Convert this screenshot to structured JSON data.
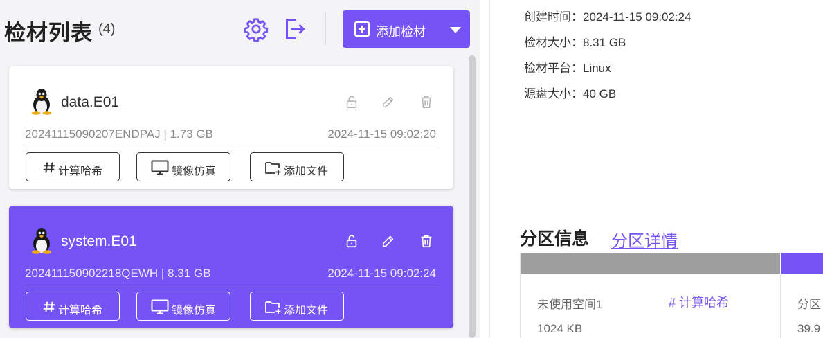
{
  "list": {
    "title": "检材列表",
    "count": "(4)",
    "add_button": "添加检材"
  },
  "cards": [
    {
      "name": "data.E01",
      "meta": "20241115090207ENDPAJ | 1.73 GB",
      "time": "2024-11-15 09:02:20",
      "btn_hash": "计算哈希",
      "btn_mirror": "镜像仿真",
      "btn_addfile": "添加文件"
    },
    {
      "name": "system.E01",
      "meta": "202411150902218QEWH | 8.31 GB",
      "time": "2024-11-15 09:02:24",
      "btn_hash": "计算哈希",
      "btn_mirror": "镜像仿真",
      "btn_addfile": "添加文件"
    }
  ],
  "details": {
    "created_label": "创建时间：",
    "created_value": "2024-11-15 09:02:24",
    "size_label": "检材大小：",
    "size_value": "8.31 GB",
    "platform_label": "检材平台：",
    "platform_value": "Linux",
    "disk_label": "源盘大小：",
    "disk_value": "40 GB"
  },
  "partition": {
    "title": "分区信息",
    "link": "分区详情",
    "unused_name": "未使用空间1",
    "hash_label": "计算哈希",
    "unused_size": "1024 KB",
    "next_name": "分区",
    "next_pct": "39.9"
  },
  "colors": {
    "accent": "#7553f4",
    "grey_bar": "#9e9e9e"
  },
  "icons": [
    "gear-icon",
    "export-icon",
    "plus-box-icon",
    "caret-down-icon",
    "linux-icon",
    "lock-icon",
    "edit-icon",
    "trash-icon",
    "hash-icon",
    "monitor-icon",
    "folder-plus-icon"
  ]
}
